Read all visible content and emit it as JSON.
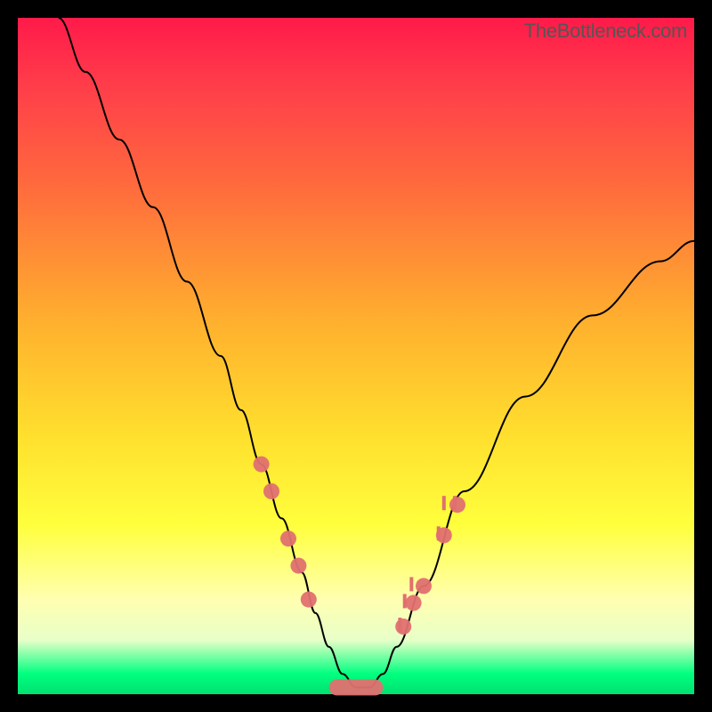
{
  "watermark": "TheBottleneck.com",
  "chart_data": {
    "type": "line",
    "title": "",
    "xlabel": "",
    "ylabel": "",
    "xlim": [
      0,
      100
    ],
    "ylim": [
      0,
      100
    ],
    "series": [
      {
        "name": "bottleneck-curve",
        "x": [
          6,
          10,
          15,
          20,
          25,
          30,
          33,
          36,
          39,
          42,
          44,
          46,
          48,
          50,
          52,
          54,
          56,
          60,
          66,
          75,
          85,
          95,
          100
        ],
        "y": [
          100,
          92,
          82,
          72,
          61,
          50,
          42,
          34,
          26,
          18,
          12,
          7,
          3,
          1,
          1,
          3,
          7,
          16,
          30,
          44,
          56,
          64,
          67
        ]
      }
    ],
    "markers_left": [
      {
        "x": 36,
        "y": 34
      },
      {
        "x": 37.5,
        "y": 30
      },
      {
        "x": 40,
        "y": 23
      },
      {
        "x": 41.5,
        "y": 19
      },
      {
        "x": 43,
        "y": 14
      }
    ],
    "markers_right": [
      {
        "x": 57,
        "y": 10
      },
      {
        "x": 58.5,
        "y": 13.5
      },
      {
        "x": 60,
        "y": 16
      },
      {
        "x": 63,
        "y": 23.5
      },
      {
        "x": 65,
        "y": 28
      }
    ],
    "flat_bottom": {
      "x_start": 46,
      "x_end": 54,
      "y": 1
    }
  }
}
